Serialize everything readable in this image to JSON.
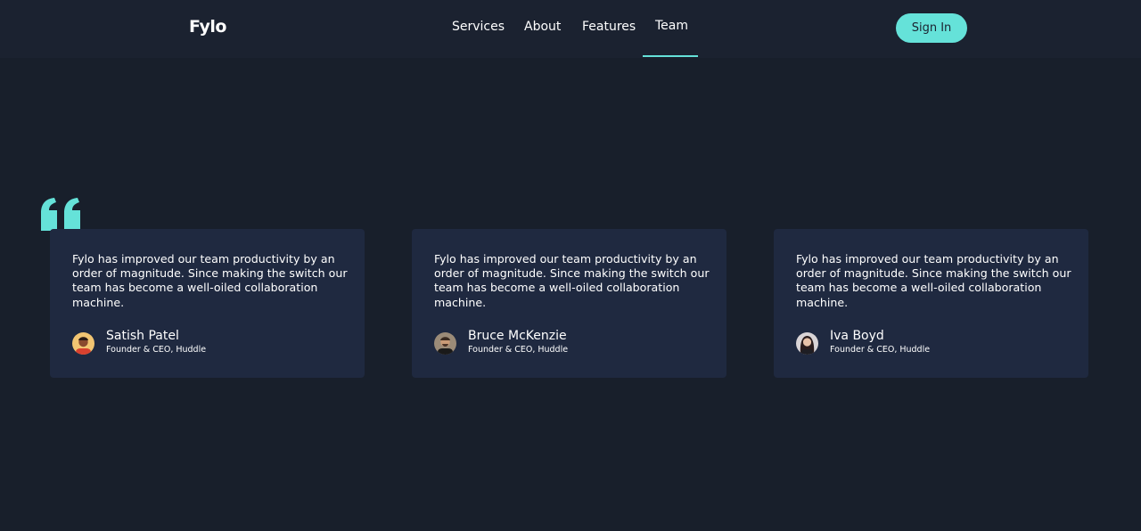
{
  "brand": {
    "logo": "Fylo"
  },
  "nav": {
    "items": [
      "Services",
      "About",
      "Features",
      "Team"
    ],
    "active": "Team"
  },
  "header": {
    "signin_label": "Sign In"
  },
  "colors": {
    "background": "#181f2b",
    "header": "#1b2230",
    "card": "#1f2940",
    "accent": "#65e2d9"
  },
  "testimonials": [
    {
      "text": "Fylo has improved our team productivity by an order of magnitude. Since making the switch our team has become a well-oiled collaboration machine.",
      "name": "Satish Patel",
      "role": "Founder & CEO, Huddle"
    },
    {
      "text": "Fylo has improved our team productivity by an order of magnitude. Since making the switch our team has become a well-oiled collaboration machine.",
      "name": "Bruce McKenzie",
      "role": "Founder & CEO, Huddle"
    },
    {
      "text": "Fylo has improved our team productivity by an order of magnitude. Since making the switch our team has become a well-oiled collaboration machine.",
      "name": "Iva Boyd",
      "role": "Founder & CEO, Huddle"
    }
  ]
}
